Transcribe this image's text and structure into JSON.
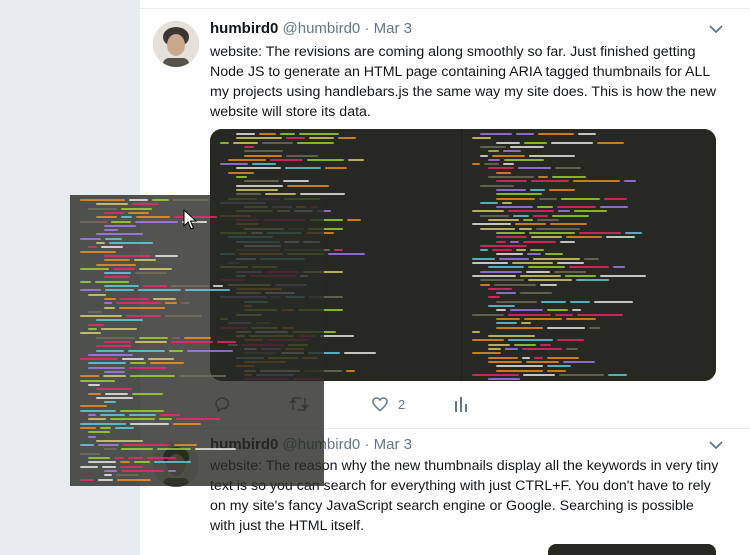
{
  "tweets": [
    {
      "name": "humbird0",
      "handle": "@humbird0",
      "separator": "·",
      "time": "Mar 3",
      "text": "website: The revisions are coming along smoothly so far. Just finished getting Node JS to generate an HTML page containing ARIA tagged thumbnails for ALL my projects using handlebars.js the same way my site does. This is how the new website will store its data.",
      "likes": "2"
    },
    {
      "name": "humbird0",
      "handle": "@humbird0",
      "separator": "·",
      "time": "Mar 3",
      "text": "website: The reason why the new thumbnails display all the keywords in very tiny text is so you can search for everything with just CTRL+F. You don't have to rely on my site's fancy JavaScript search engine or Google. Searching is possible with just the HTML itself."
    }
  ],
  "icons": {
    "caret": "chevron-down-icon",
    "reply": "reply-icon",
    "retweet": "retweet-icon",
    "like": "heart-icon",
    "analytics": "analytics-icon"
  },
  "colors": {
    "text": "#14171a",
    "secondary": "#657786",
    "background": "#e6ecf0",
    "code_bg": "#272822"
  }
}
